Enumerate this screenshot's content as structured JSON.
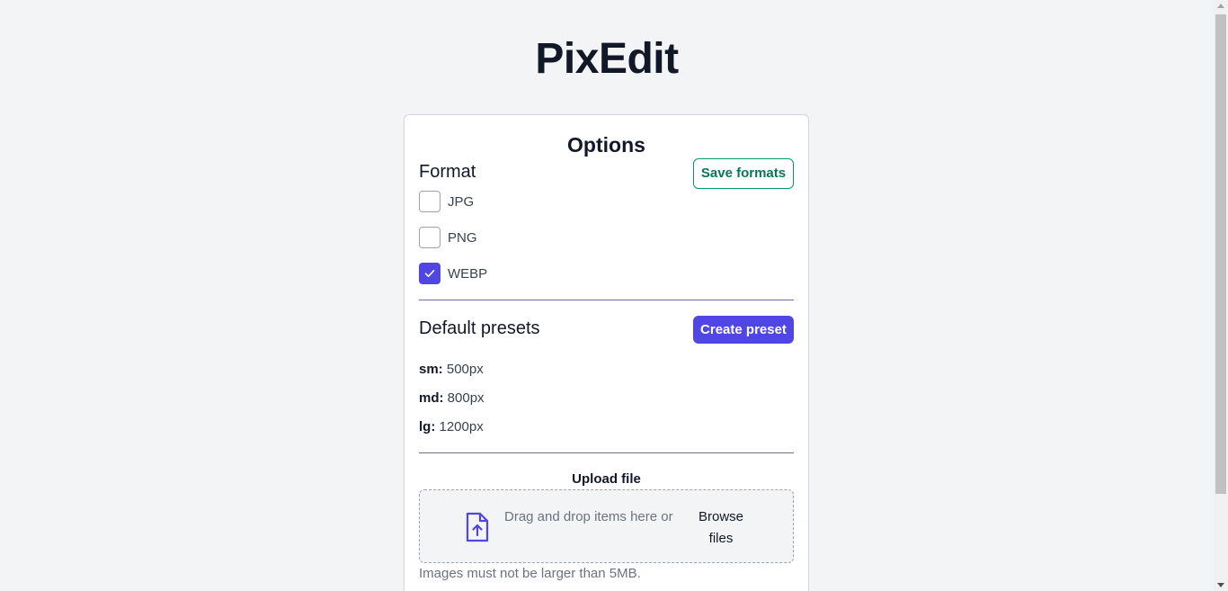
{
  "header": {
    "title": "PixEdit"
  },
  "options": {
    "title": "Options",
    "format": {
      "heading": "Format",
      "save_label": "Save formats",
      "items": [
        {
          "label": "JPG",
          "checked": false
        },
        {
          "label": "PNG",
          "checked": false
        },
        {
          "label": "WEBP",
          "checked": true
        }
      ]
    },
    "presets": {
      "heading": "Default presets",
      "create_label": "Create preset",
      "items": [
        {
          "key": "sm:",
          "value": "500px"
        },
        {
          "key": "md:",
          "value": "800px"
        },
        {
          "key": "lg:",
          "value": "1200px"
        }
      ]
    },
    "upload": {
      "label": "Upload file",
      "drop_text": "Drag and drop items here or",
      "browse_label": "Browse files",
      "hint": "Images must not be larger than 5MB."
    }
  },
  "colors": {
    "accent": "#4f46e5",
    "success": "#059669",
    "background": "#f3f4f6"
  },
  "icons": {
    "upload": "file-upload-icon",
    "check": "check-icon"
  }
}
